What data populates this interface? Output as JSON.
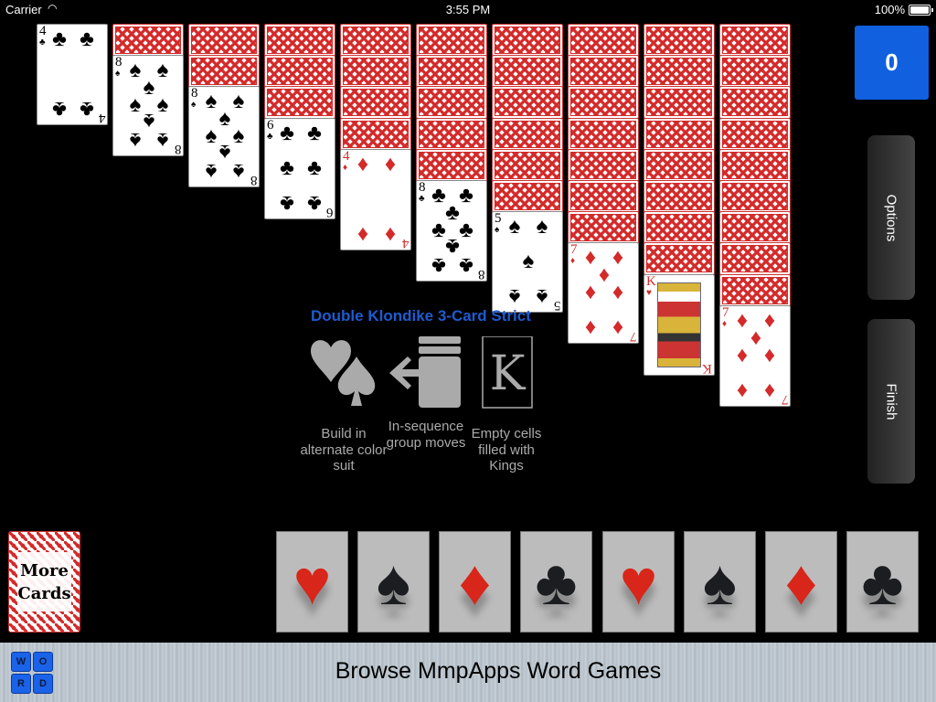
{
  "status_bar": {
    "carrier": "Carrier",
    "wifi_icon": "wifi-icon",
    "time": "3:55 PM",
    "battery": "100%"
  },
  "score": "0",
  "side_buttons": {
    "options": "Options",
    "finish": "Finish"
  },
  "tableau": [
    {
      "face_down": 0,
      "face_up": {
        "rank": "4",
        "suit": "♣",
        "color": "black"
      }
    },
    {
      "face_down": 1,
      "face_up": {
        "rank": "8",
        "suit": "♠",
        "color": "black"
      }
    },
    {
      "face_down": 2,
      "face_up": {
        "rank": "8",
        "suit": "♠",
        "color": "black"
      }
    },
    {
      "face_down": 3,
      "face_up": {
        "rank": "6",
        "suit": "♣",
        "color": "black"
      }
    },
    {
      "face_down": 4,
      "face_up": {
        "rank": "4",
        "suit": "♦",
        "color": "red"
      }
    },
    {
      "face_down": 5,
      "face_up": {
        "rank": "8",
        "suit": "♣",
        "color": "black"
      }
    },
    {
      "face_down": 6,
      "face_up": {
        "rank": "5",
        "suit": "♠",
        "color": "black"
      }
    },
    {
      "face_down": 7,
      "face_up": {
        "rank": "7",
        "suit": "♦",
        "color": "red"
      }
    },
    {
      "face_down": 8,
      "face_up": {
        "rank": "K",
        "suit": "♥",
        "color": "red"
      }
    },
    {
      "face_down": 9,
      "face_up": {
        "rank": "7",
        "suit": "♦",
        "color": "red"
      }
    }
  ],
  "game_info": {
    "title": "Double Klondike 3-Card Strict",
    "rules": [
      {
        "icon": "alternate-suits-icon",
        "label": "Build in alternate color suit"
      },
      {
        "icon": "group-move-icon",
        "label": "In-sequence group moves"
      },
      {
        "icon": "king-card-icon",
        "label": "Empty cells filled with Kings",
        "glyph": "K"
      }
    ]
  },
  "stock": {
    "line1": "More",
    "line2": "Cards"
  },
  "foundations": [
    {
      "suit": "♥",
      "color": "red",
      "name": "hearts"
    },
    {
      "suit": "♠",
      "color": "black",
      "name": "spades"
    },
    {
      "suit": "♦",
      "color": "red",
      "name": "diamonds"
    },
    {
      "suit": "♣",
      "color": "black",
      "name": "clubs"
    },
    {
      "suit": "♥",
      "color": "red",
      "name": "hearts"
    },
    {
      "suit": "♠",
      "color": "black",
      "name": "spades"
    },
    {
      "suit": "♦",
      "color": "red",
      "name": "diamonds"
    },
    {
      "suit": "♣",
      "color": "black",
      "name": "clubs"
    }
  ],
  "banner": {
    "logo_letters": [
      "W",
      "O",
      "R",
      "D"
    ],
    "title": "Browse MmpApps Word Games"
  }
}
